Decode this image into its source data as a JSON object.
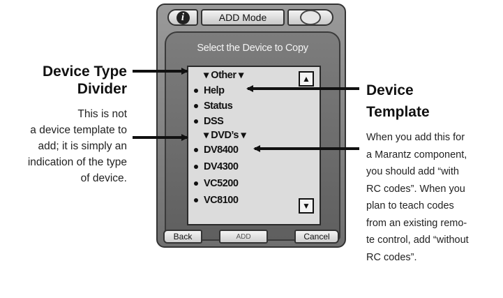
{
  "left_annotation": {
    "title_line1": "Device Type",
    "title_line2": "Divider",
    "body_lines": [
      "This is not",
      "a device template to",
      "add; it is simply an",
      "indication of the type",
      "of device."
    ]
  },
  "right_annotation": {
    "title_line1": "Device",
    "title_line2": "Template",
    "body_lines": [
      "When you add this for",
      "a Marantz component,",
      "you should add “with",
      "RC codes”. When you",
      "plan to teach codes",
      "from an existing remo-",
      "te control, add “without",
      "RC codes”."
    ]
  },
  "device": {
    "info_icon": "i",
    "mode_label": "ADD Mode",
    "prompt": "Select the Device to Copy",
    "list": {
      "divider_other": "▾ Other ▾",
      "items_other": [
        "Help",
        "Status",
        "DSS"
      ],
      "divider_dvd": "▾ DVD’s ▾",
      "items_dvd": [
        "DV8400",
        "DV4300",
        "VC5200",
        "VC8100"
      ]
    },
    "scroll_up_glyph": "▲",
    "scroll_down_glyph": "▼",
    "softkeys": {
      "back": "Back",
      "middle": "ADD",
      "cancel": "Cancel"
    }
  }
}
